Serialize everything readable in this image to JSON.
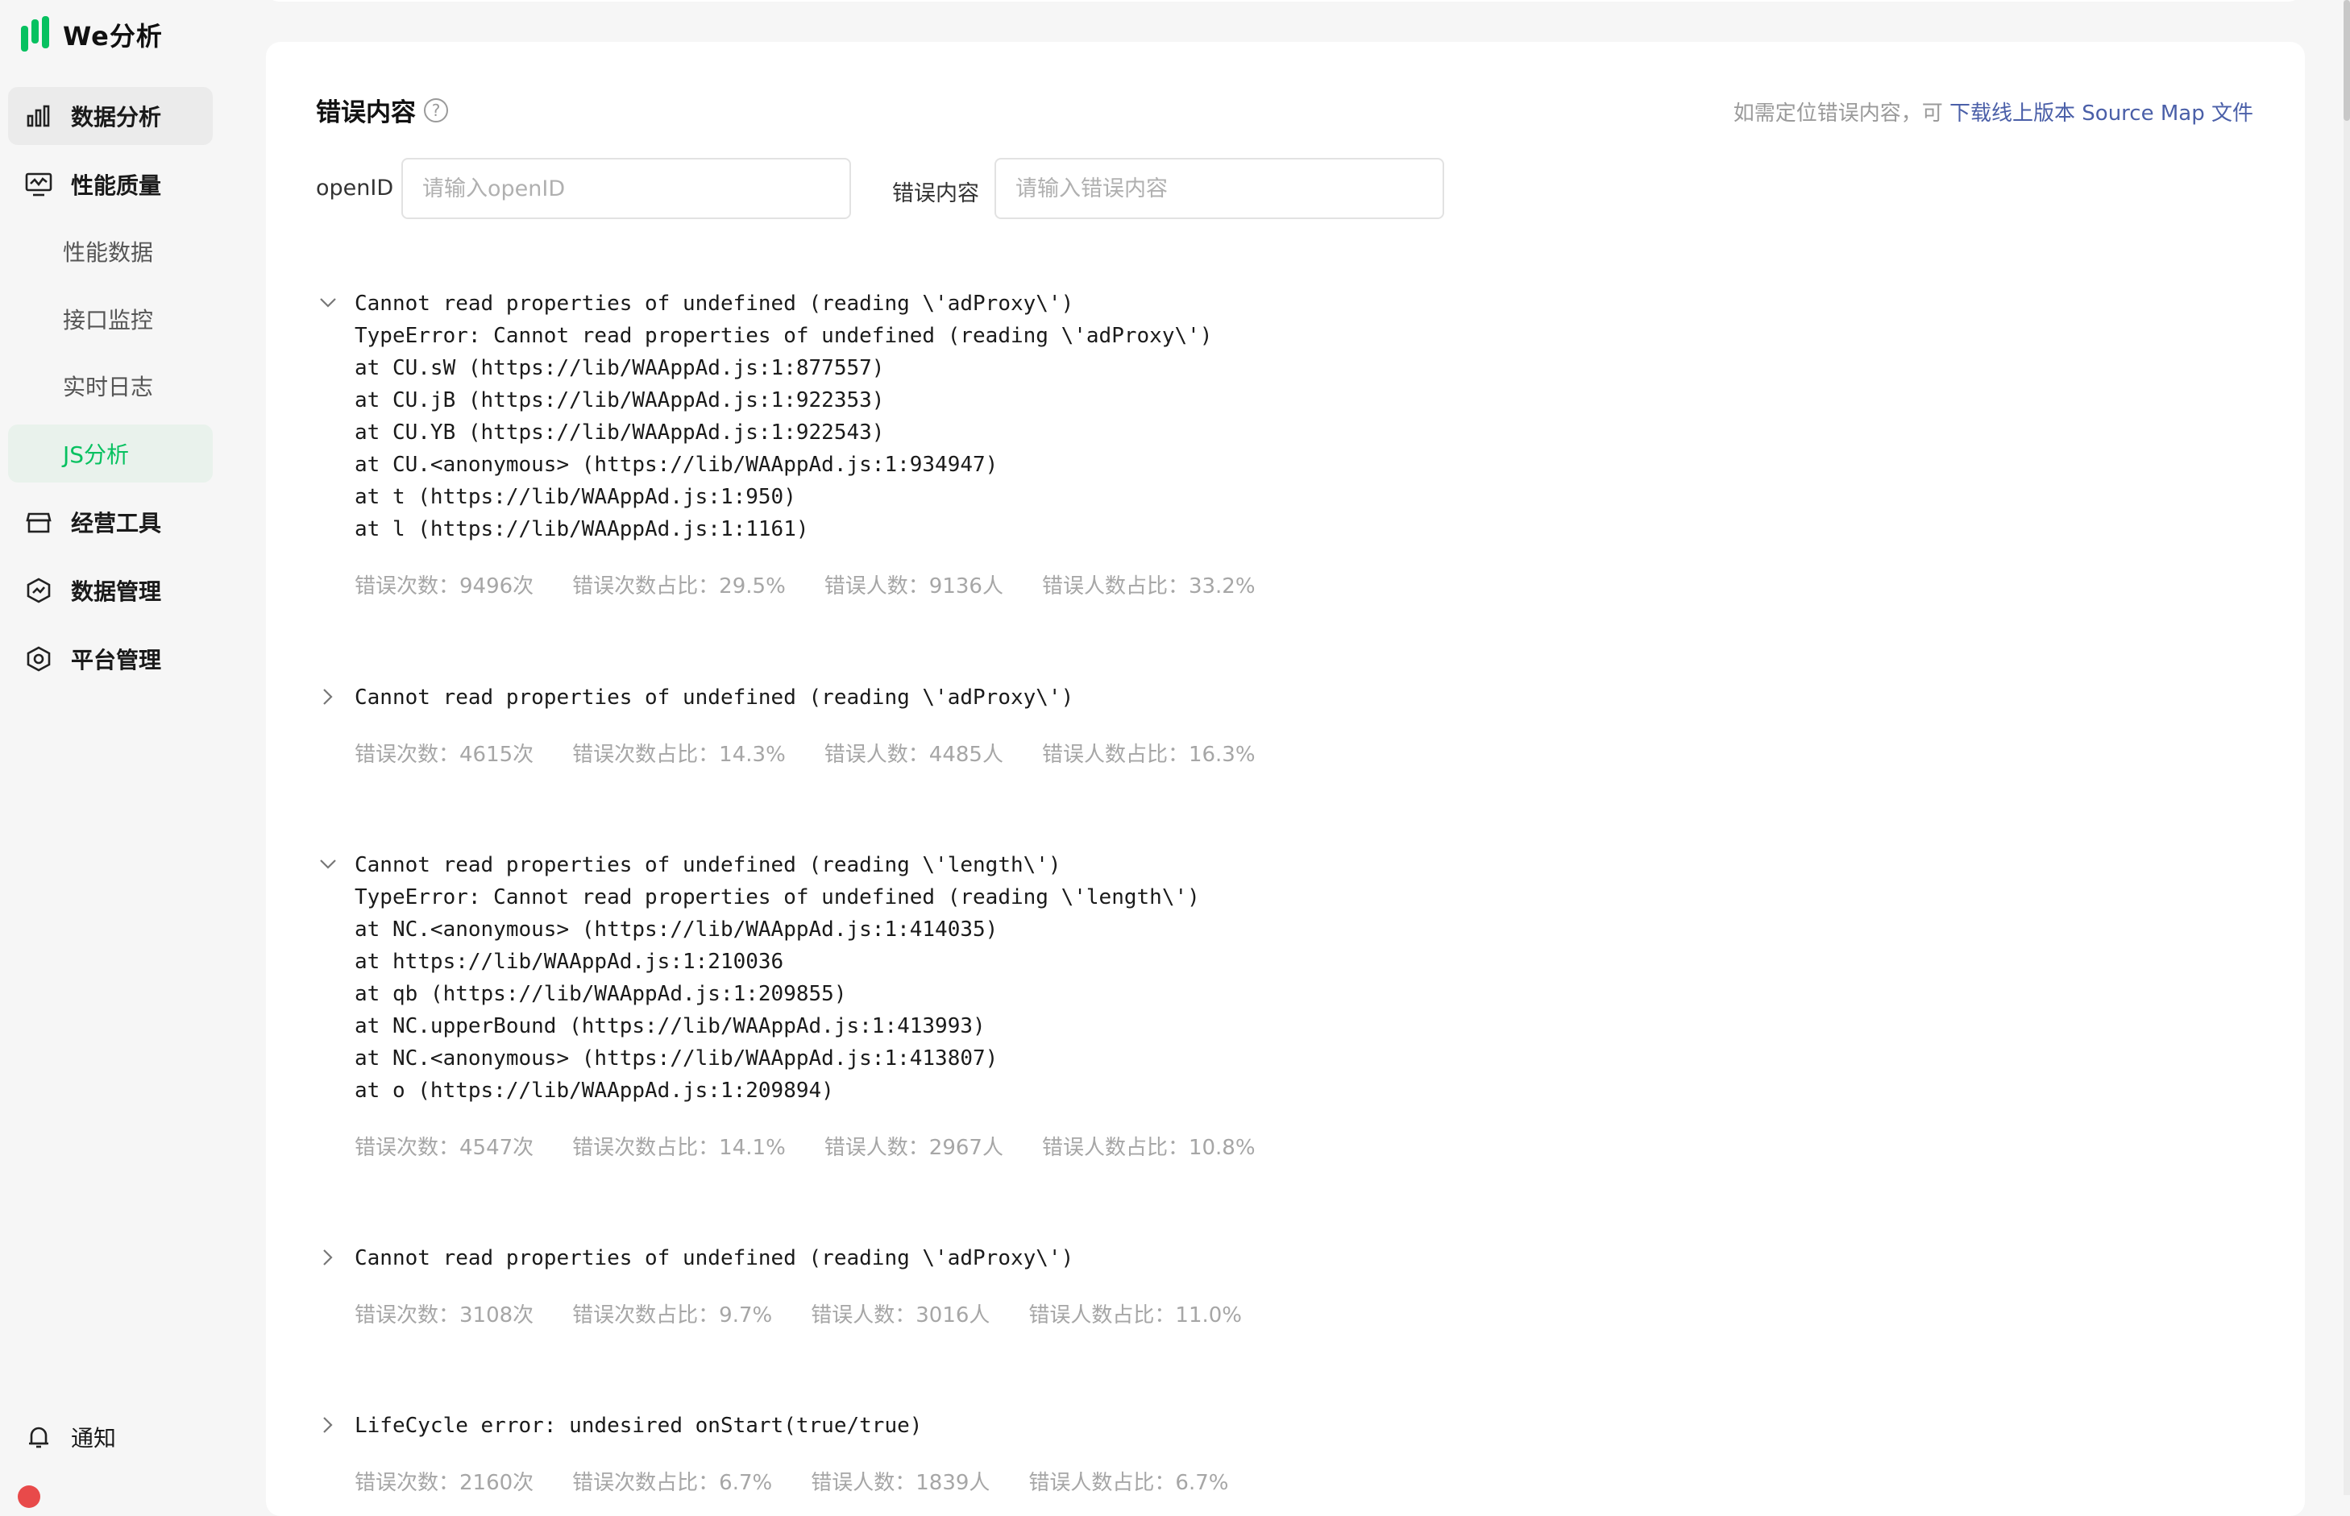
{
  "app": {
    "name": "We分析"
  },
  "sidebar": {
    "items": [
      {
        "label": "数据分析",
        "icon": "bar-chart-icon"
      },
      {
        "label": "性能质量",
        "icon": "monitor-icon"
      },
      {
        "label": "性能数据"
      },
      {
        "label": "接口监控"
      },
      {
        "label": "实时日志"
      },
      {
        "label": "JS分析"
      },
      {
        "label": "经营工具",
        "icon": "store-icon"
      },
      {
        "label": "数据管理",
        "icon": "data-shield-icon"
      },
      {
        "label": "平台管理",
        "icon": "hexagon-settings-icon"
      }
    ],
    "notify": {
      "label": "通知",
      "icon": "bell-icon"
    }
  },
  "colors": {
    "accent": "#07c160",
    "link": "#4a5fa8",
    "muted": "#a6a6a6"
  },
  "main": {
    "title": "错误内容",
    "hint_prefix": "如需定位错误内容，可 ",
    "hint_link": "下载线上版本 Source Map 文件",
    "filters": {
      "openid_label": "openID",
      "openid_placeholder": "请输入openID",
      "content_label": "错误内容",
      "content_placeholder": "请输入错误内容"
    },
    "errors": [
      {
        "expanded": true,
        "trace": "Cannot read properties of undefined (reading \\'adProxy\\')\nTypeError: Cannot read properties of undefined (reading \\'adProxy\\')\nat CU.sW (https://lib/WAAppAd.js:1:877557)\nat CU.jB (https://lib/WAAppAd.js:1:922353)\nat CU.YB (https://lib/WAAppAd.js:1:922543)\nat CU.<anonymous> (https://lib/WAAppAd.js:1:934947)\nat t (https://lib/WAAppAd.js:1:950)\nat l (https://lib/WAAppAd.js:1:1161)",
        "stats": [
          "错误次数：9496次",
          "错误次数占比：29.5%",
          "错误人数：9136人",
          "错误人数占比：33.2%"
        ]
      },
      {
        "expanded": false,
        "trace": "Cannot read properties of undefined (reading \\'adProxy\\')",
        "stats": [
          "错误次数：4615次",
          "错误次数占比：14.3%",
          "错误人数：4485人",
          "错误人数占比：16.3%"
        ]
      },
      {
        "expanded": true,
        "trace": "Cannot read properties of undefined (reading \\'length\\')\nTypeError: Cannot read properties of undefined (reading \\'length\\')\nat NC.<anonymous> (https://lib/WAAppAd.js:1:414035)\nat https://lib/WAAppAd.js:1:210036\nat qb (https://lib/WAAppAd.js:1:209855)\nat NC.upperBound (https://lib/WAAppAd.js:1:413993)\nat NC.<anonymous> (https://lib/WAAppAd.js:1:413807)\nat o (https://lib/WAAppAd.js:1:209894)",
        "stats": [
          "错误次数：4547次",
          "错误次数占比：14.1%",
          "错误人数：2967人",
          "错误人数占比：10.8%"
        ]
      },
      {
        "expanded": false,
        "trace": "Cannot read properties of undefined (reading \\'adProxy\\')",
        "stats": [
          "错误次数：3108次",
          "错误次数占比：9.7%",
          "错误人数：3016人",
          "错误人数占比：11.0%"
        ]
      },
      {
        "expanded": false,
        "trace": "LifeCycle error: undesired onStart(true/true)",
        "stats": [
          "错误次数：2160次",
          "错误次数占比：6.7%",
          "错误人数：1839人",
          "错误人数占比：6.7%"
        ]
      }
    ]
  }
}
